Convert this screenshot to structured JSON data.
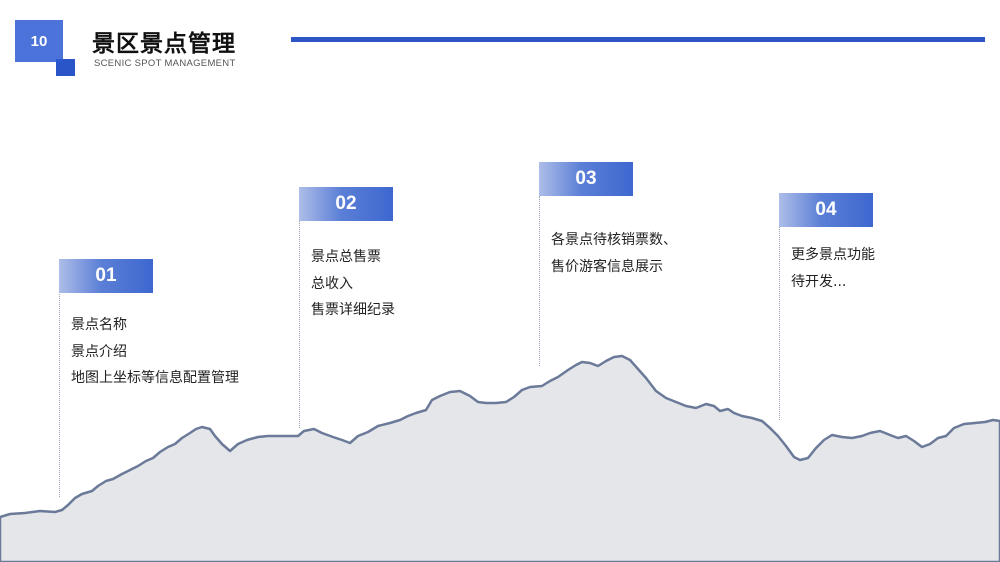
{
  "header": {
    "number": "10",
    "title": "景区景点管理",
    "subtitle": "SCENIC SPOT MANAGEMENT"
  },
  "steps": [
    {
      "number": "01",
      "lines": [
        "景点名称",
        "景点介绍",
        "地图上坐标等信息配置管理"
      ]
    },
    {
      "number": "02",
      "lines": [
        "景点总售票",
        "总收入",
        "售票详细纪录"
      ]
    },
    {
      "number": "03",
      "lines": [
        "各景点待核销票数、",
        "售价游客信息展示"
      ]
    },
    {
      "number": "04",
      "lines": [
        "更多景点功能",
        "待开发..."
      ]
    }
  ],
  "colors": {
    "accent": "#2d5bd3",
    "mountain_fill": "#e4e6ea",
    "mountain_stroke": "#6a7a98"
  }
}
